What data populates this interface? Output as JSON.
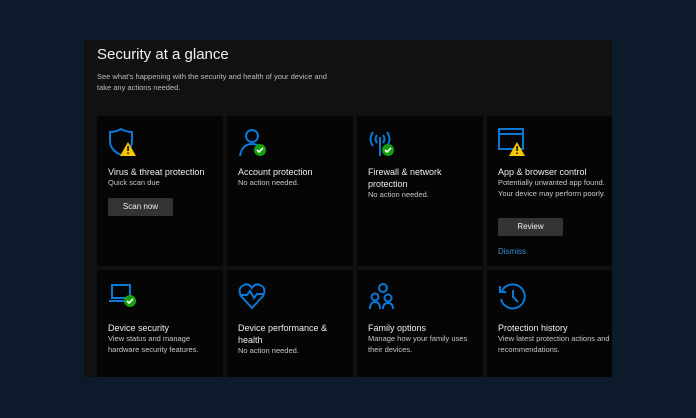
{
  "header": {
    "title": "Security at a glance",
    "subtitle": "See what's happening with the security and health of your device and take any actions needed."
  },
  "colors": {
    "accent": "#0a78d4",
    "warning": "#f8c700",
    "ok": "#13a10e"
  },
  "cards": [
    {
      "title": "Virus & threat protection",
      "desc": "Quick scan due",
      "button": "Scan now",
      "icon": "shield-warning-icon",
      "status": "warning"
    },
    {
      "title": "Account protection",
      "desc": "No action needed.",
      "icon": "person-check-icon",
      "status": "ok"
    },
    {
      "title": "Firewall & network protection",
      "desc": "No action needed.",
      "icon": "antenna-check-icon",
      "status": "ok"
    },
    {
      "title": "App & browser control",
      "desc": "Potentially unwanted app found. Your device may perform poorly.",
      "button": "Review",
      "link": "Dismiss",
      "icon": "browser-warning-icon",
      "status": "warning"
    },
    {
      "title": "Device security",
      "desc": "View status and manage hardware security features.",
      "icon": "laptop-check-icon",
      "status": "ok"
    },
    {
      "title": "Device performance & health",
      "desc": "No action needed.",
      "icon": "heart-pulse-icon"
    },
    {
      "title": "Family options",
      "desc": "Manage how your family uses their devices.",
      "icon": "family-icon"
    },
    {
      "title": "Protection history",
      "desc": "View latest protection actions and recommendations.",
      "icon": "history-icon"
    }
  ]
}
